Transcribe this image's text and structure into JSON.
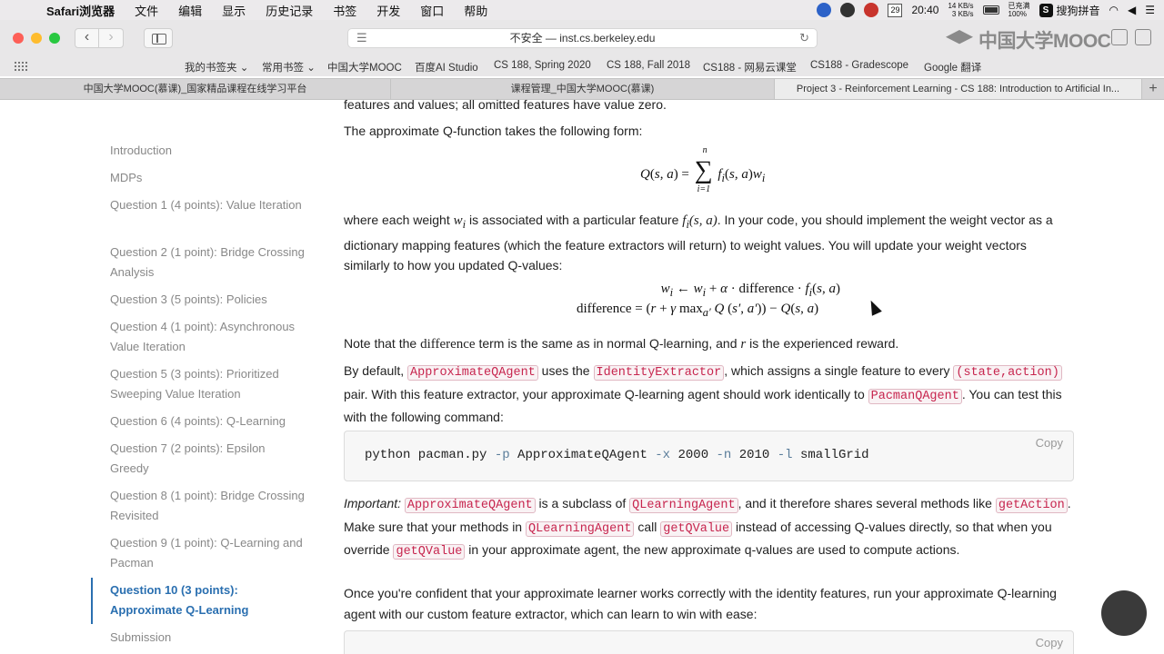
{
  "menubar": {
    "app": "Safari浏览器",
    "items": [
      "文件",
      "编辑",
      "显示",
      "历史记录",
      "书签",
      "开发",
      "窗口",
      "帮助"
    ],
    "calendar_day": "29",
    "time": "20:40",
    "net_up": "14 KB/s",
    "net_down": "3 KB/s",
    "battery_status": "已充满",
    "battery_percent": "100%",
    "ime_label": "搜狗拼音"
  },
  "toolbar": {
    "url": "不安全 — inst.cs.berkeley.edu",
    "watermark": "中国大学MOOC"
  },
  "bookmarks": [
    "我的书签夹 ⌄",
    "常用书签 ⌄",
    "中国大学MOOC",
    "百度AI Studio",
    "CS 188, Spring 2020",
    "CS 188, Fall 2018",
    "CS188 - 网易云课堂",
    "CS188 - Gradescope",
    "Google 翻译"
  ],
  "tabs": [
    {
      "label": "中国大学MOOC(慕课)_国家精品课程在线学习平台",
      "active": false
    },
    {
      "label": "课程管理_中国大学MOOC(慕课)",
      "active": false
    },
    {
      "label": "Project 3 - Reinforcement Learning - CS 188: Introduction to Artificial In...",
      "active": true
    }
  ],
  "sidebar": {
    "items": [
      {
        "label": "Introduction"
      },
      {
        "label": "MDPs"
      },
      {
        "label": "Question 1 (4 points): Value Iteration"
      },
      {
        "label": "Question 2 (1 point): Bridge Crossing Analysis"
      },
      {
        "label": "Question 3 (5 points): Policies"
      },
      {
        "label": "Question 4 (1 point): Asynchronous Value Iteration"
      },
      {
        "label": "Question 5 (3 points): Prioritized Sweeping Value Iteration"
      },
      {
        "label": "Question 6 (4 points): Q-Learning"
      },
      {
        "label": "Question 7 (2 points): Epsilon Greedy"
      },
      {
        "label": "Question 8 (1 point): Bridge Crossing Revisited"
      },
      {
        "label": "Question 9 (1 point): Q-Learning and Pacman"
      },
      {
        "label": "Question 10 (3 points): Approximate Q-Learning"
      },
      {
        "label": "Submission"
      }
    ],
    "active_index": 11
  },
  "content": {
    "top_cut": "features and values; all omitted features have value zero.",
    "p1": "The approximate Q-function takes the following form:",
    "p2_a": "where each weight",
    "p2_b": "is associated with a particular feature",
    "p2_c": ". In your code, you should implement the weight vector as a dictionary mapping features (which the feature extractors will return) to weight values. You will update your weight vectors similarly to how you updated Q-values:",
    "p3_a": "Note that the",
    "p3_term": "difference",
    "p3_b": "term is the same as in normal Q-learning, and",
    "p3_r": "r",
    "p3_c": "is the experienced reward.",
    "p4_a": "By default,",
    "p4_code1": "ApproximateQAgent",
    "p4_b": "uses the",
    "p4_code2": "IdentityExtractor",
    "p4_c": ", which assigns a single feature to every",
    "p4_code3": "(state,action)",
    "p4_d": "pair. With this feature extractor, your approximate Q-learning agent should work identically to",
    "p4_code4": "PacmanQAgent",
    "p4_e": ". You can test this with the following command:",
    "cmd_prefix": "python pacman.py ",
    "cmd_flag1": "-p",
    "cmd_arg1": " ApproximateQAgent ",
    "cmd_flag2": "-x",
    "cmd_arg2": " 2000 ",
    "cmd_flag3": "-n",
    "cmd_arg3": " 2010 ",
    "cmd_flag4": "-l",
    "cmd_arg4": " smallGrid",
    "copy_label": "Copy",
    "p5_important": "Important:",
    "p5_code1": "ApproximateQAgent",
    "p5_a": "is a subclass of",
    "p5_code2": "QLearningAgent",
    "p5_b": ", and it therefore shares several methods like",
    "p5_code3": "getAction",
    "p5_c": ". Make sure that your methods in",
    "p5_code4": "QLearningAgent",
    "p5_d": "call",
    "p5_code5": "getQValue",
    "p5_e": "instead of accessing Q-values directly, so that when you override",
    "p5_code6": "getQValue",
    "p5_f": "in your approximate agent, the new approximate q-values are used to compute actions.",
    "p6": "Once you're confident that your approximate learner works correctly with the identity features, run your approximate Q-learning agent with our custom feature extractor, which can learn to win with ease:"
  }
}
